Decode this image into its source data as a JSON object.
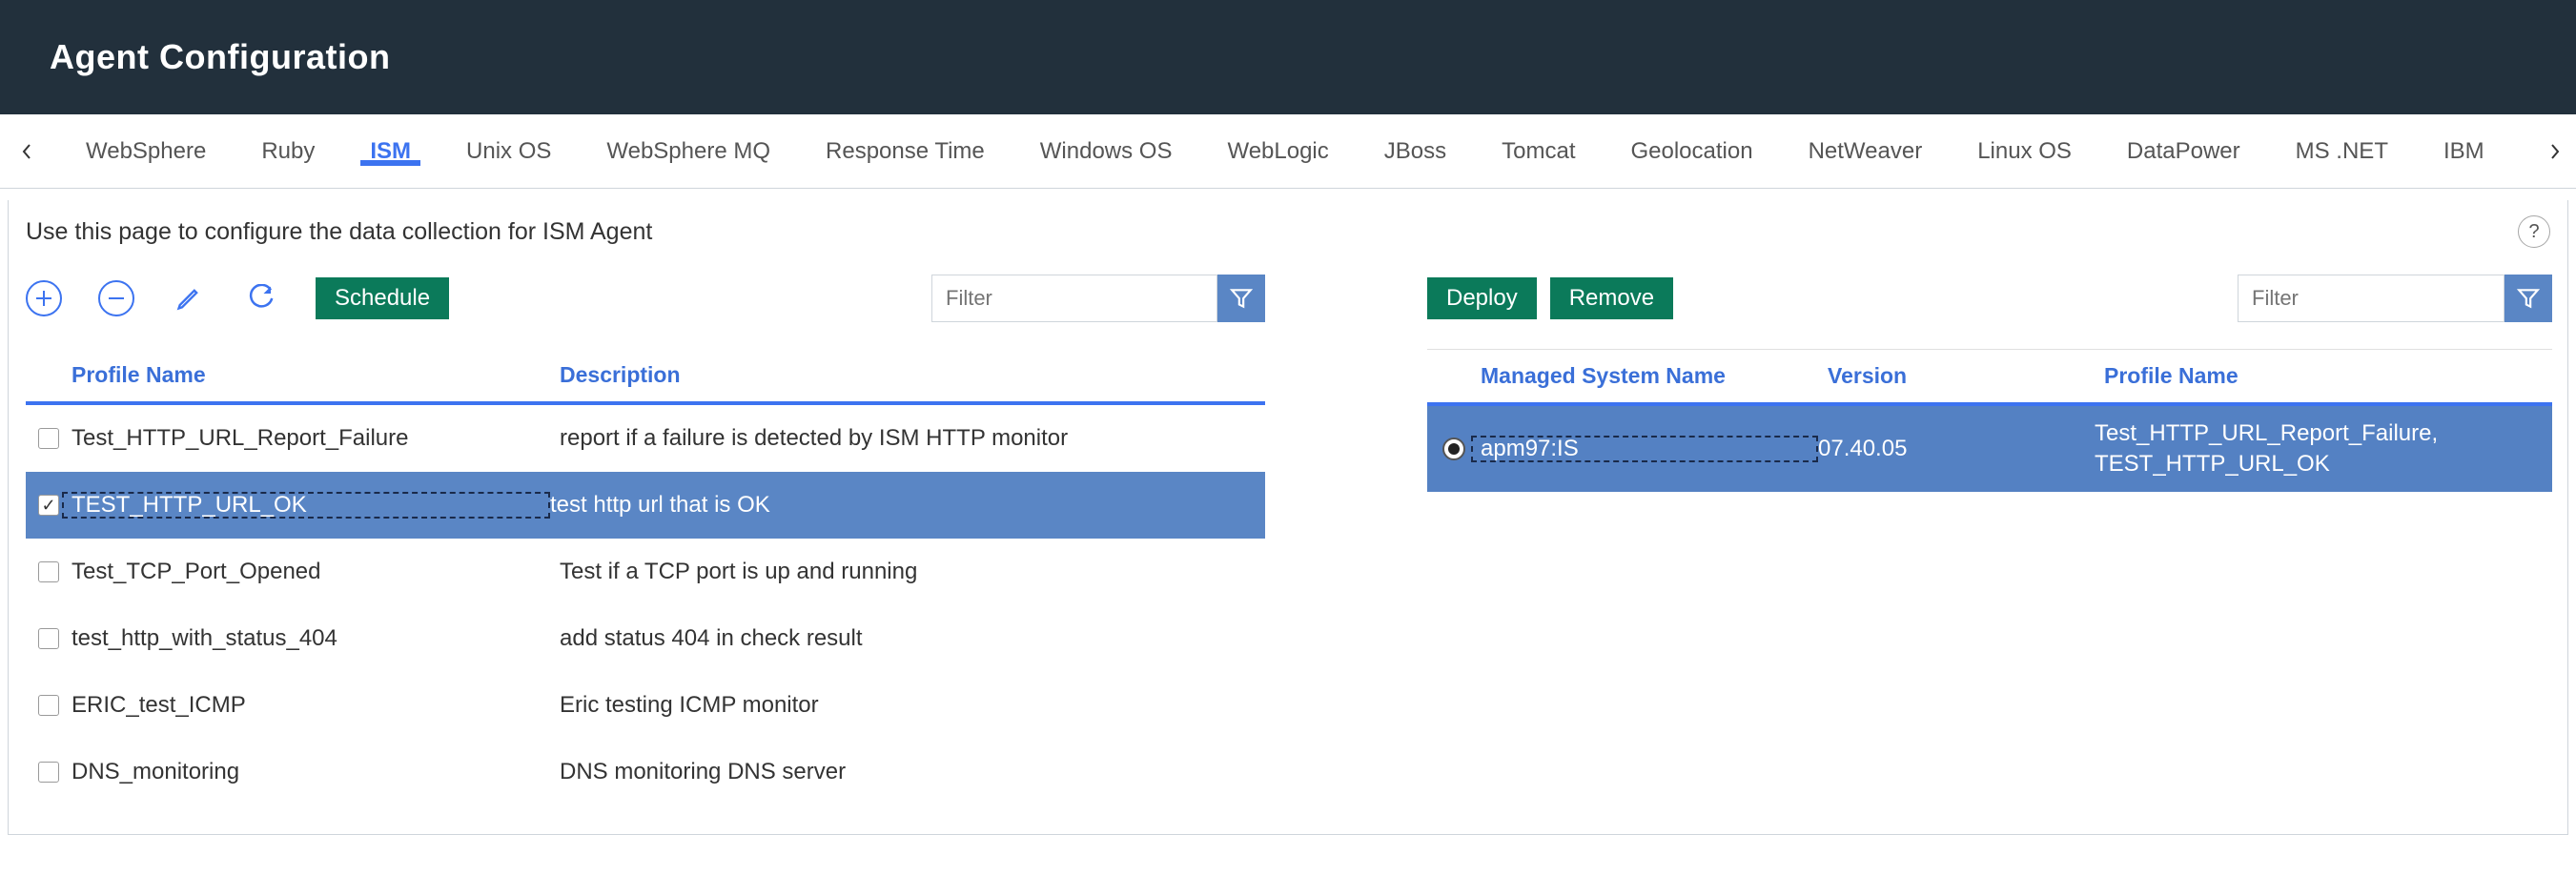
{
  "header": {
    "title": "Agent Configuration"
  },
  "tabs": {
    "items": [
      {
        "label": "WebSphere",
        "active": false
      },
      {
        "label": "Ruby",
        "active": false
      },
      {
        "label": "ISM",
        "active": true
      },
      {
        "label": "Unix OS",
        "active": false
      },
      {
        "label": "WebSphere MQ",
        "active": false
      },
      {
        "label": "Response Time",
        "active": false
      },
      {
        "label": "Windows OS",
        "active": false
      },
      {
        "label": "WebLogic",
        "active": false
      },
      {
        "label": "JBoss",
        "active": false
      },
      {
        "label": "Tomcat",
        "active": false
      },
      {
        "label": "Geolocation",
        "active": false
      },
      {
        "label": "NetWeaver",
        "active": false
      },
      {
        "label": "Linux OS",
        "active": false
      },
      {
        "label": "DataPower",
        "active": false
      },
      {
        "label": "MS .NET",
        "active": false
      },
      {
        "label": "IBM",
        "active": false
      }
    ]
  },
  "instruction": "Use this page to configure the data collection for ISM Agent",
  "helpTooltip": "?",
  "left": {
    "toolbar": {
      "add_name": "add-button",
      "remove_name": "remove-button",
      "edit_name": "edit-button",
      "refresh_name": "refresh-button",
      "schedule_label": "Schedule",
      "filter_placeholder": "Filter"
    },
    "columns": {
      "profile": "Profile Name",
      "description": "Description"
    },
    "rows": [
      {
        "checked": false,
        "profile": "Test_HTTP_URL_Report_Failure",
        "description": "report if a failure is detected by ISM HTTP monitor",
        "selected": false
      },
      {
        "checked": true,
        "profile": "TEST_HTTP_URL_OK",
        "description": "test http url that is OK",
        "selected": true
      },
      {
        "checked": false,
        "profile": "Test_TCP_Port_Opened",
        "description": "Test if a TCP port is up and running",
        "selected": false
      },
      {
        "checked": false,
        "profile": "test_http_with_status_404",
        "description": "add status 404 in check result",
        "selected": false
      },
      {
        "checked": false,
        "profile": "ERIC_test_ICMP",
        "description": "Eric testing ICMP monitor",
        "selected": false
      },
      {
        "checked": false,
        "profile": "DNS_monitoring",
        "description": "DNS monitoring DNS server",
        "selected": false
      }
    ]
  },
  "right": {
    "toolbar": {
      "deploy_label": "Deploy",
      "remove_label": "Remove",
      "filter_placeholder": "Filter"
    },
    "columns": {
      "managed": "Managed System Name",
      "version": "Version",
      "profile": "Profile Name"
    },
    "rows": [
      {
        "selected": true,
        "picked": true,
        "managed": "apm97:IS",
        "version": "07.40.05",
        "profile": "Test_HTTP_URL_Report_Failure, TEST_HTTP_URL_OK"
      }
    ]
  }
}
